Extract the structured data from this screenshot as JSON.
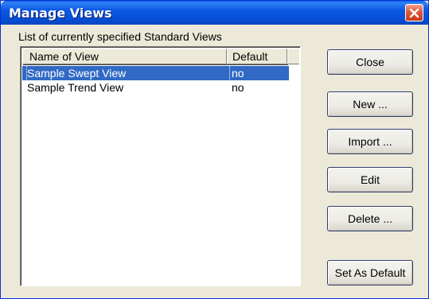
{
  "window": {
    "title": "Manage Views"
  },
  "list": {
    "caption": "List of currently specified Standard Views",
    "columns": [
      "Name of View",
      "Default"
    ],
    "rows": [
      {
        "name": "Sample Swept View",
        "default": "no",
        "selected": true
      },
      {
        "name": "Sample Trend View",
        "default": "no",
        "selected": false
      }
    ]
  },
  "buttons": {
    "close": "Close",
    "new": "New ...",
    "import": "Import ...",
    "edit": "Edit",
    "delete": "Delete ...",
    "set_default": "Set As Default"
  },
  "colors": {
    "titlebar": "#0650d8",
    "selection": "#316ac5",
    "dialog_bg": "#ece9d8"
  }
}
